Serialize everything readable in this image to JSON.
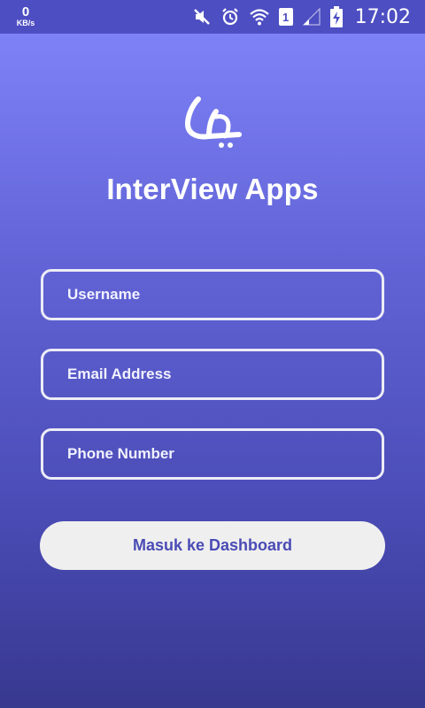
{
  "status_bar": {
    "net_speed_value": "0",
    "net_speed_unit": "KB/s",
    "sim_label": "1",
    "time": "17:02",
    "icons": [
      "mute-icon",
      "alarm-icon",
      "wifi-icon",
      "sim-icon",
      "signal-icon",
      "battery-charging-icon"
    ]
  },
  "app": {
    "logo_icon": "signature-logo-icon",
    "title": "InterView Apps"
  },
  "form": {
    "username_placeholder": "Username",
    "email_placeholder": "Email Address",
    "phone_placeholder": "Phone Number",
    "submit_label": "Masuk ke Dashboard"
  },
  "colors": {
    "gradient_top": "#8286fb",
    "gradient_bottom": "#37388f",
    "status_bar": "#4d4ec2",
    "button_bg": "#efefef",
    "button_text": "#4a4bb5"
  }
}
